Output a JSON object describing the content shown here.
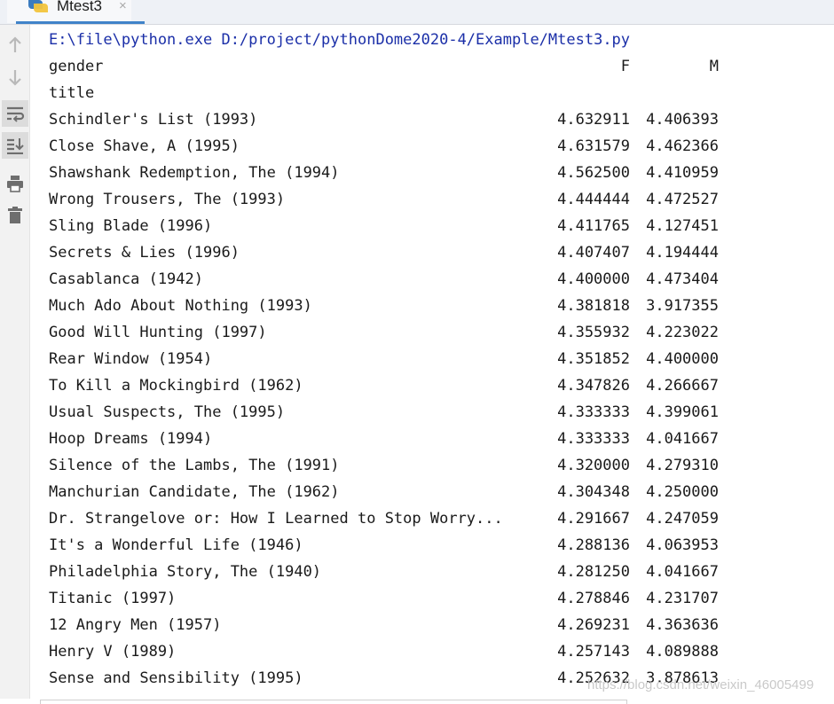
{
  "tab": {
    "title": "Mtest3",
    "close": "×"
  },
  "console": {
    "command": "E:\\file\\python.exe D:/project/pythonDome2020-4/Example/Mtest3.py",
    "header": {
      "label": "gender",
      "col_f": "F",
      "col_m": "M"
    },
    "index_name": "title",
    "rows": [
      {
        "title": "Schindler's List (1993)",
        "f": "4.632911",
        "m": "4.406393"
      },
      {
        "title": "Close Shave, A (1995)",
        "f": "4.631579",
        "m": "4.462366"
      },
      {
        "title": "Shawshank Redemption, The (1994)",
        "f": "4.562500",
        "m": "4.410959"
      },
      {
        "title": "Wrong Trousers, The (1993)",
        "f": "4.444444",
        "m": "4.472527"
      },
      {
        "title": "Sling Blade (1996)",
        "f": "4.411765",
        "m": "4.127451"
      },
      {
        "title": "Secrets & Lies (1996)",
        "f": "4.407407",
        "m": "4.194444"
      },
      {
        "title": "Casablanca (1942)",
        "f": "4.400000",
        "m": "4.473404"
      },
      {
        "title": "Much Ado About Nothing (1993)",
        "f": "4.381818",
        "m": "3.917355"
      },
      {
        "title": "Good Will Hunting (1997)",
        "f": "4.355932",
        "m": "4.223022"
      },
      {
        "title": "Rear Window (1954)",
        "f": "4.351852",
        "m": "4.400000"
      },
      {
        "title": "To Kill a Mockingbird (1962)",
        "f": "4.347826",
        "m": "4.266667"
      },
      {
        "title": "Usual Suspects, The (1995)",
        "f": "4.333333",
        "m": "4.399061"
      },
      {
        "title": "Hoop Dreams (1994)",
        "f": "4.333333",
        "m": "4.041667"
      },
      {
        "title": "Silence of the Lambs, The (1991)",
        "f": "4.320000",
        "m": "4.279310"
      },
      {
        "title": "Manchurian Candidate, The (1962)",
        "f": "4.304348",
        "m": "4.250000"
      },
      {
        "title": "Dr. Strangelove or: How I Learned to Stop Worry...",
        "f": "4.291667",
        "m": "4.247059"
      },
      {
        "title": "It's a Wonderful Life (1946)",
        "f": "4.288136",
        "m": "4.063953"
      },
      {
        "title": "Philadelphia Story, The (1940)",
        "f": "4.281250",
        "m": "4.041667"
      },
      {
        "title": "Titanic (1997)",
        "f": "4.278846",
        "m": "4.231707"
      },
      {
        "title": "12 Angry Men (1957)",
        "f": "4.269231",
        "m": "4.363636"
      },
      {
        "title": "Henry V (1989)",
        "f": "4.257143",
        "m": "4.089888"
      },
      {
        "title": "Sense and Sensibility (1995)",
        "f": "4.252632",
        "m": "3.878613"
      }
    ]
  },
  "toolbar": {
    "items": [
      {
        "icon": "up-arrow-icon"
      },
      {
        "icon": "down-arrow-icon"
      },
      {
        "icon": "soft-wrap-icon",
        "active": true
      },
      {
        "icon": "scroll-to-end-icon",
        "active": true
      },
      {
        "icon": "print-icon"
      },
      {
        "icon": "trash-icon"
      }
    ]
  },
  "watermark": "https://blog.csdn.net/weixin_46005499",
  "colors": {
    "command": "#1b2fa8",
    "tab_accent": "#4083c9",
    "text": "#1a1a1a"
  }
}
